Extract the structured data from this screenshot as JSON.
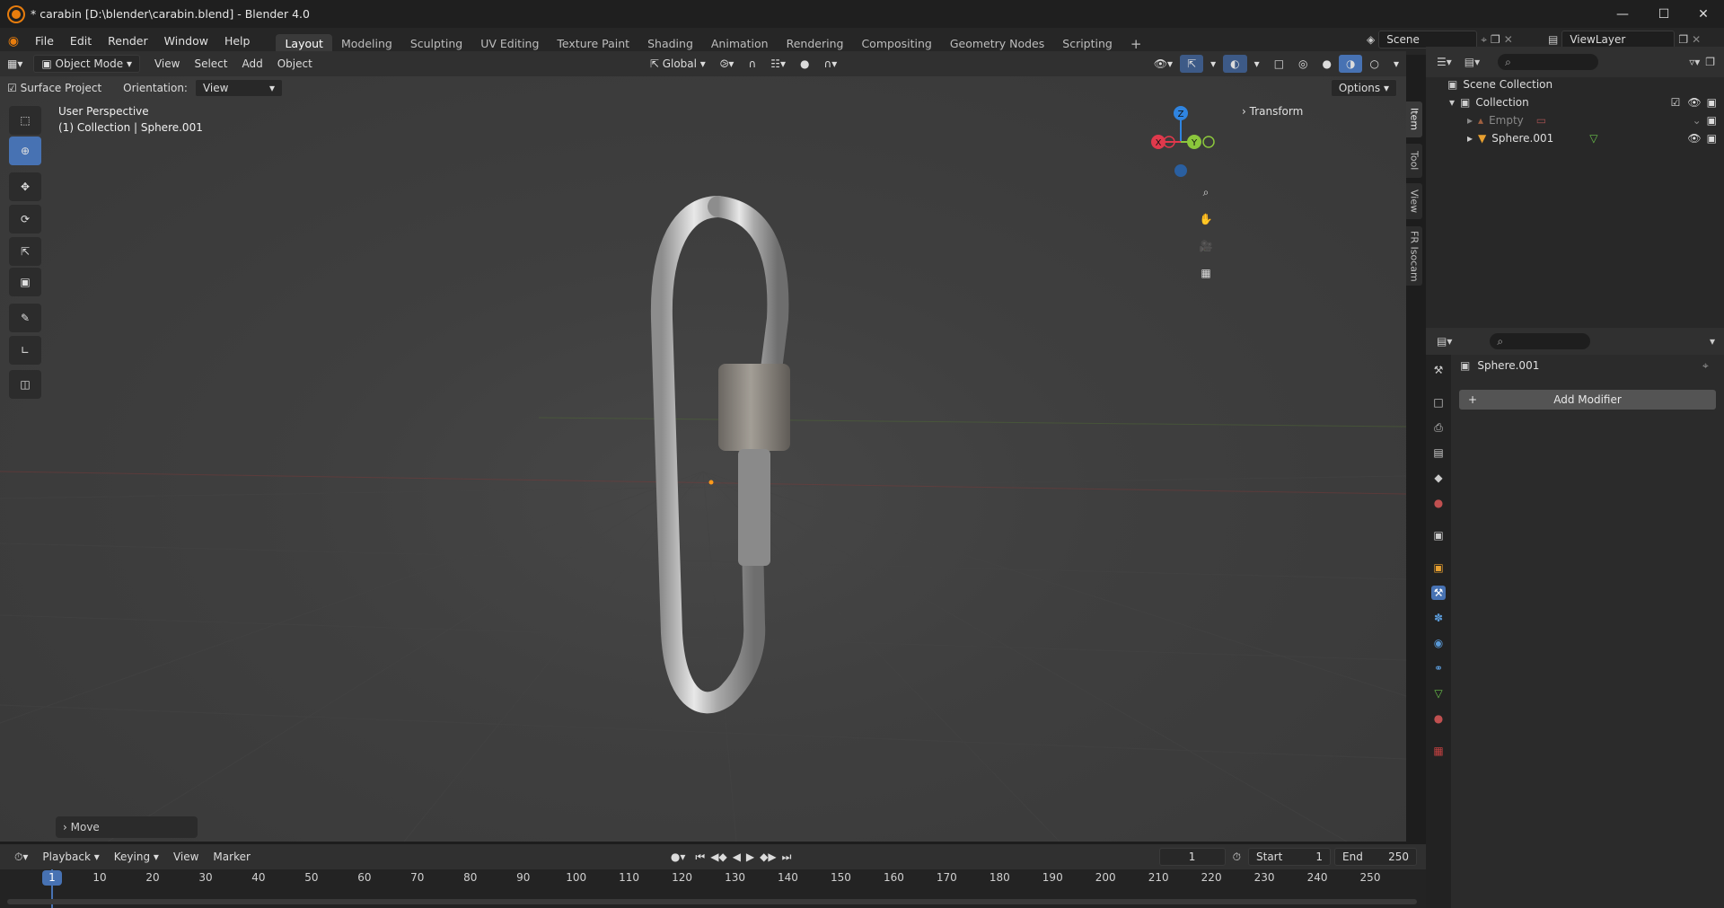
{
  "window": {
    "title": "* carabin [D:\\blender\\carabin.blend] - Blender 4.0"
  },
  "menus": [
    "File",
    "Edit",
    "Render",
    "Window",
    "Help"
  ],
  "workspaces": [
    "Layout",
    "Modeling",
    "Sculpting",
    "UV Editing",
    "Texture Paint",
    "Shading",
    "Animation",
    "Rendering",
    "Compositing",
    "Geometry Nodes",
    "Scripting"
  ],
  "scene": {
    "name": "Scene"
  },
  "view_layer": {
    "name": "ViewLayer"
  },
  "viewport_header": {
    "mode": "Object Mode",
    "menus": [
      "View",
      "Select",
      "Add",
      "Object"
    ],
    "transform_orientation": "Global",
    "surface_project": "Surface Project",
    "orientation_label": "Orientation:",
    "orientation_value": "View",
    "options": "Options"
  },
  "viewport": {
    "perspective": "User Perspective",
    "collection_info": "(1) Collection | Sphere.001",
    "transform_panel": "Transform",
    "side_tabs": [
      "Item",
      "Tool",
      "View",
      "FR Isocam"
    ],
    "gizmo": {
      "x": "X",
      "y": "Y",
      "z": "Z"
    },
    "last_op": "Move"
  },
  "outliner": {
    "root": "Scene Collection",
    "collection": "Collection",
    "items": [
      {
        "name": "Empty"
      },
      {
        "name": "Sphere.001"
      }
    ]
  },
  "properties": {
    "object_name": "Sphere.001",
    "add_modifier": "Add Modifier"
  },
  "timeline": {
    "menus": [
      "Playback",
      "Keying",
      "View",
      "Marker"
    ],
    "current_frame": "1",
    "start_label": "Start",
    "start": "1",
    "end_label": "End",
    "end": "250",
    "ruler": [
      "1",
      "10",
      "20",
      "30",
      "40",
      "50",
      "60",
      "70",
      "80",
      "90",
      "100",
      "110",
      "120",
      "130",
      "140",
      "150",
      "160",
      "170",
      "180",
      "190",
      "200",
      "210",
      "220",
      "230",
      "240",
      "250"
    ]
  },
  "colors": {
    "accent": "#4772b3",
    "x_axis": "#e0394c",
    "y_axis": "#8bc63c",
    "z_axis": "#2f84e0",
    "blender_orange": "#e87d0d"
  }
}
